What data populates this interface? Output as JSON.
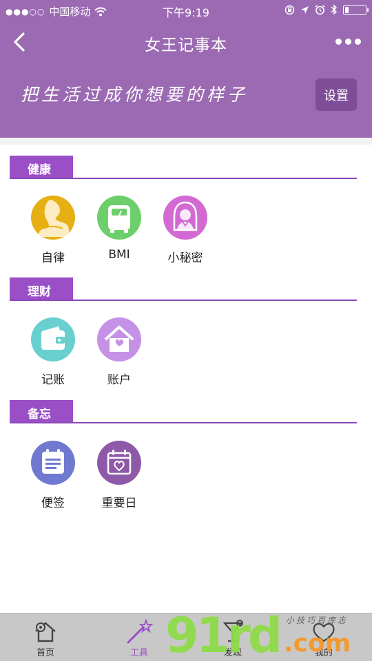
{
  "status_bar": {
    "signal": "●●●○○",
    "carrier": "中国移动",
    "time": "下午9:19"
  },
  "nav": {
    "title": "女王记事本"
  },
  "banner": {
    "slogan": "把生活过成你想要的样子",
    "settings_label": "设置"
  },
  "sections": [
    {
      "title": "健康",
      "tools": [
        {
          "label": "自律",
          "icon": "yoga-icon",
          "color": "#e6b014"
        },
        {
          "label": "BMI",
          "icon": "scale-icon",
          "color": "#6ccf6b"
        },
        {
          "label": "小秘密",
          "icon": "woman-icon",
          "color": "#d36ad3"
        }
      ]
    },
    {
      "title": "理财",
      "tools": [
        {
          "label": "记账",
          "icon": "wallet-icon",
          "color": "#6ad0cf"
        },
        {
          "label": "账户",
          "icon": "house-heart-icon",
          "color": "#c591e6"
        }
      ]
    },
    {
      "title": "备忘",
      "tools": [
        {
          "label": "便签",
          "icon": "notepad-icon",
          "color": "#6e79cf"
        },
        {
          "label": "重要日",
          "icon": "calendar-heart-icon",
          "color": "#8e5aa8"
        }
      ]
    }
  ],
  "tabbar": {
    "tabs": [
      {
        "label": "首页",
        "icon": "home-icon"
      },
      {
        "label": "工具",
        "icon": "magic-wand-icon",
        "active": true
      },
      {
        "label": "发现",
        "icon": "cocktail-icon"
      },
      {
        "label": "我的",
        "icon": "heart-icon"
      }
    ]
  },
  "watermark": {
    "brand": "91rd",
    "suffix": ".com",
    "tagline": "小技巧百库志"
  },
  "colors": {
    "header": "#9b6ab3",
    "accent": "#9b4fc7",
    "settings_button": "#7e4d97",
    "tabbar": "#c9c8c8"
  }
}
